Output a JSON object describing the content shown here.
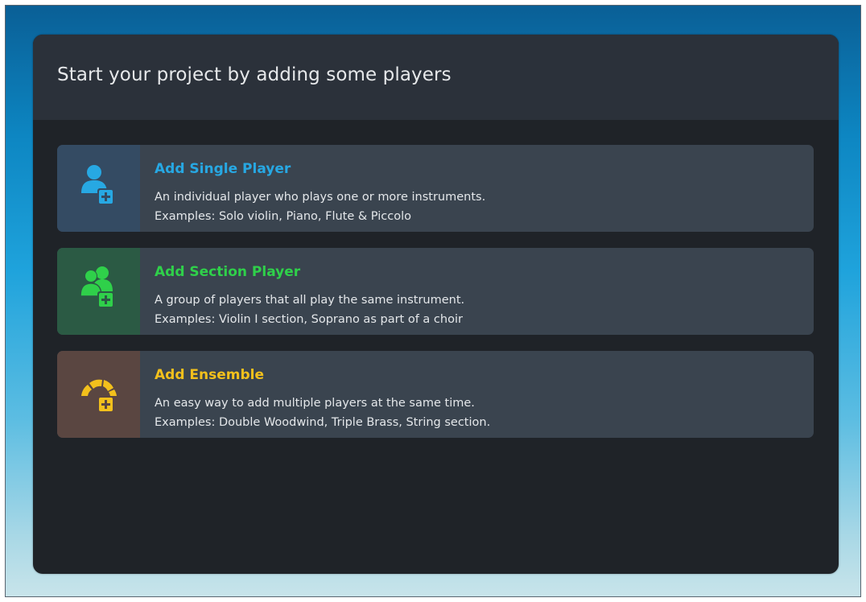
{
  "dialog": {
    "title": "Start your project by adding some players"
  },
  "options": [
    {
      "title": "Add Single Player",
      "description": "An individual player who plays one or more instruments.",
      "examples": "Examples: Solo violin, Piano, Flute & Piccolo",
      "icon": "single-player-add-icon",
      "accent_color": "#27a8e3",
      "icon_bg_color": "#344b63"
    },
    {
      "title": "Add Section Player",
      "description": "A group of players that all play the same instrument.",
      "examples": "Examples: Violin I section, Soprano as part of a choir",
      "icon": "section-player-add-icon",
      "accent_color": "#2fd04a",
      "icon_bg_color": "#2b5a44"
    },
    {
      "title": "Add Ensemble",
      "description": "An easy way to add multiple players at the same time.",
      "examples": "Examples: Double Woodwind, Triple Brass, String section.",
      "icon": "ensemble-add-icon",
      "accent_color": "#f2c01c",
      "icon_bg_color": "#5a4641"
    }
  ]
}
